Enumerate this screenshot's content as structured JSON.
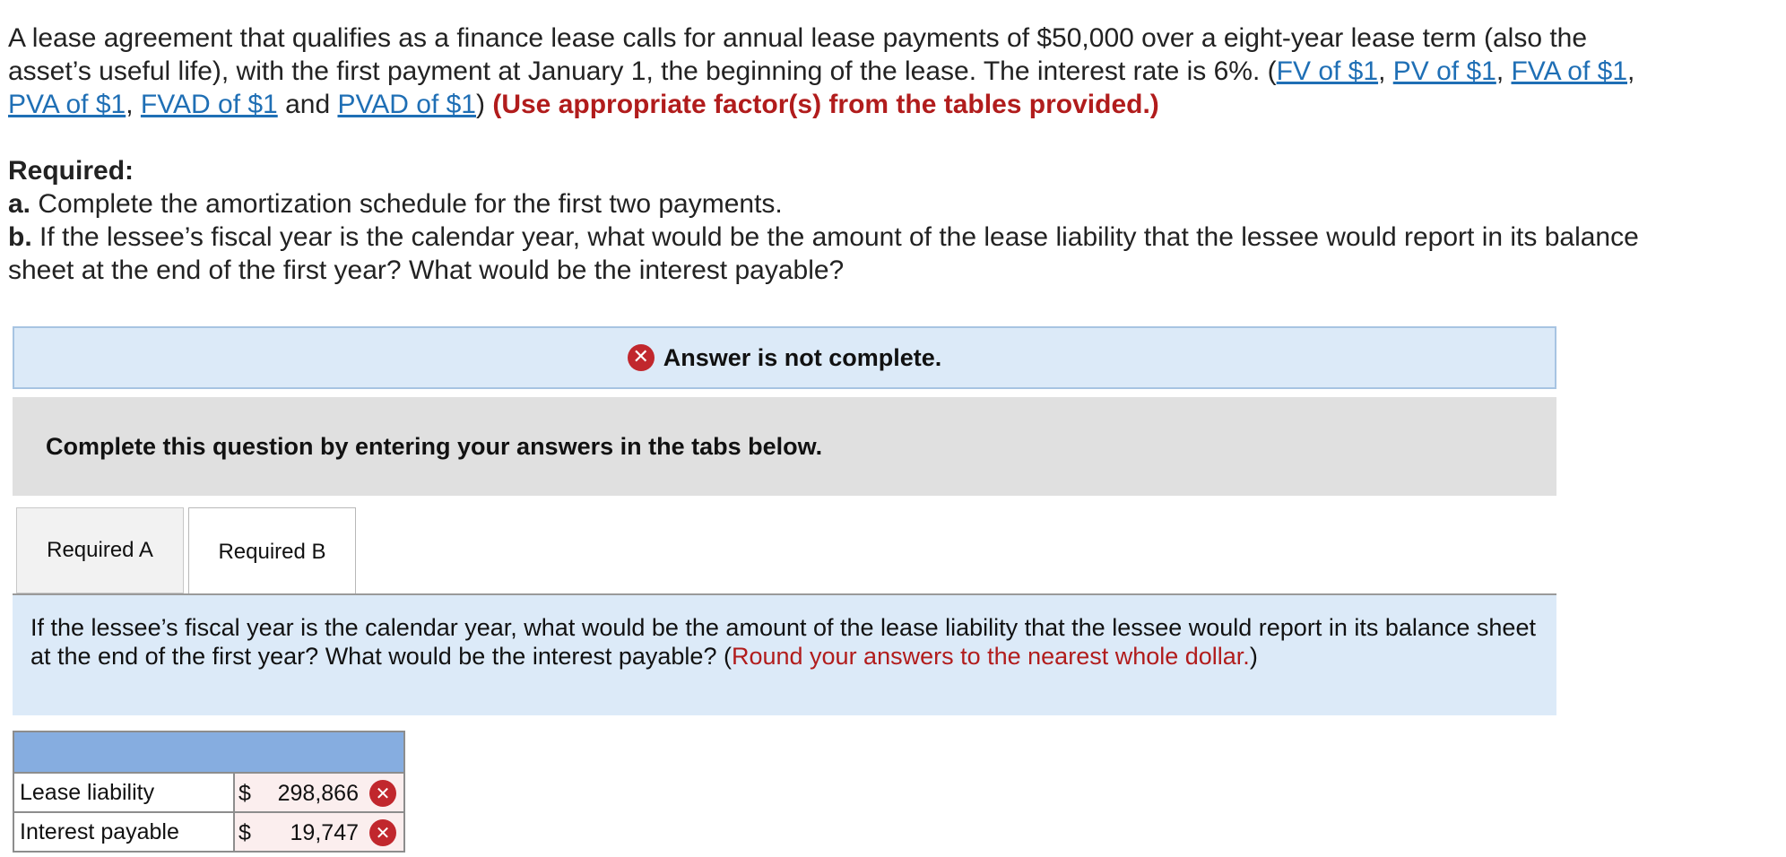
{
  "problem": {
    "text_1": "A lease agreement that qualifies as a finance lease calls for annual lease payments of $50,000 over a eight-year lease term (also the asset’s useful life), with the first payment at January 1, the beginning of the lease. The interest rate is 6%. (",
    "links": [
      "FV of $1",
      "PV of $1",
      "FVA of $1",
      "PVA of $1",
      "FVAD of $1",
      "PVAD of $1"
    ],
    "sep_comma": ", ",
    "sep_and": " and ",
    "close_paren": ") ",
    "instruction": "(Use appropriate factor(s) from the tables provided.)"
  },
  "required": {
    "heading": "Required:",
    "a_prefix": "a.",
    "a_text": " Complete the amortization schedule for the first two payments.",
    "b_prefix": "b.",
    "b_text": " If the lessee’s fiscal year is the calendar year, what would be the amount of the lease liability that the lessee would report in its balance sheet at the end of the first year? What would be the interest payable?"
  },
  "banner": {
    "text": "Answer is not complete.",
    "icon": "close-icon"
  },
  "instruction_box": {
    "text": "Complete this question by entering your answers in the tabs below."
  },
  "tabs": [
    {
      "label": "Required A",
      "active": false
    },
    {
      "label": "Required B",
      "active": true
    }
  ],
  "panel": {
    "question": "If the lessee’s fiscal year is the calendar year, what would be the amount of the lease liability that the lessee would report in its balance sheet at the end of the first year? What would be the interest payable? (",
    "hint": "Round your answers to the nearest whole dollar.",
    "close": ")"
  },
  "answers": {
    "currency": "$",
    "rows": [
      {
        "label": "Lease liability",
        "value": "298,866",
        "status": "incorrect"
      },
      {
        "label": "Interest payable",
        "value": "19,747",
        "status": "incorrect"
      }
    ]
  },
  "colors": {
    "link": "#1f6fb5",
    "error_red": "#c1272d",
    "instruction_red": "#b11c1c",
    "banner_bg": "#dceaf8",
    "header_blue": "#86ade0"
  }
}
